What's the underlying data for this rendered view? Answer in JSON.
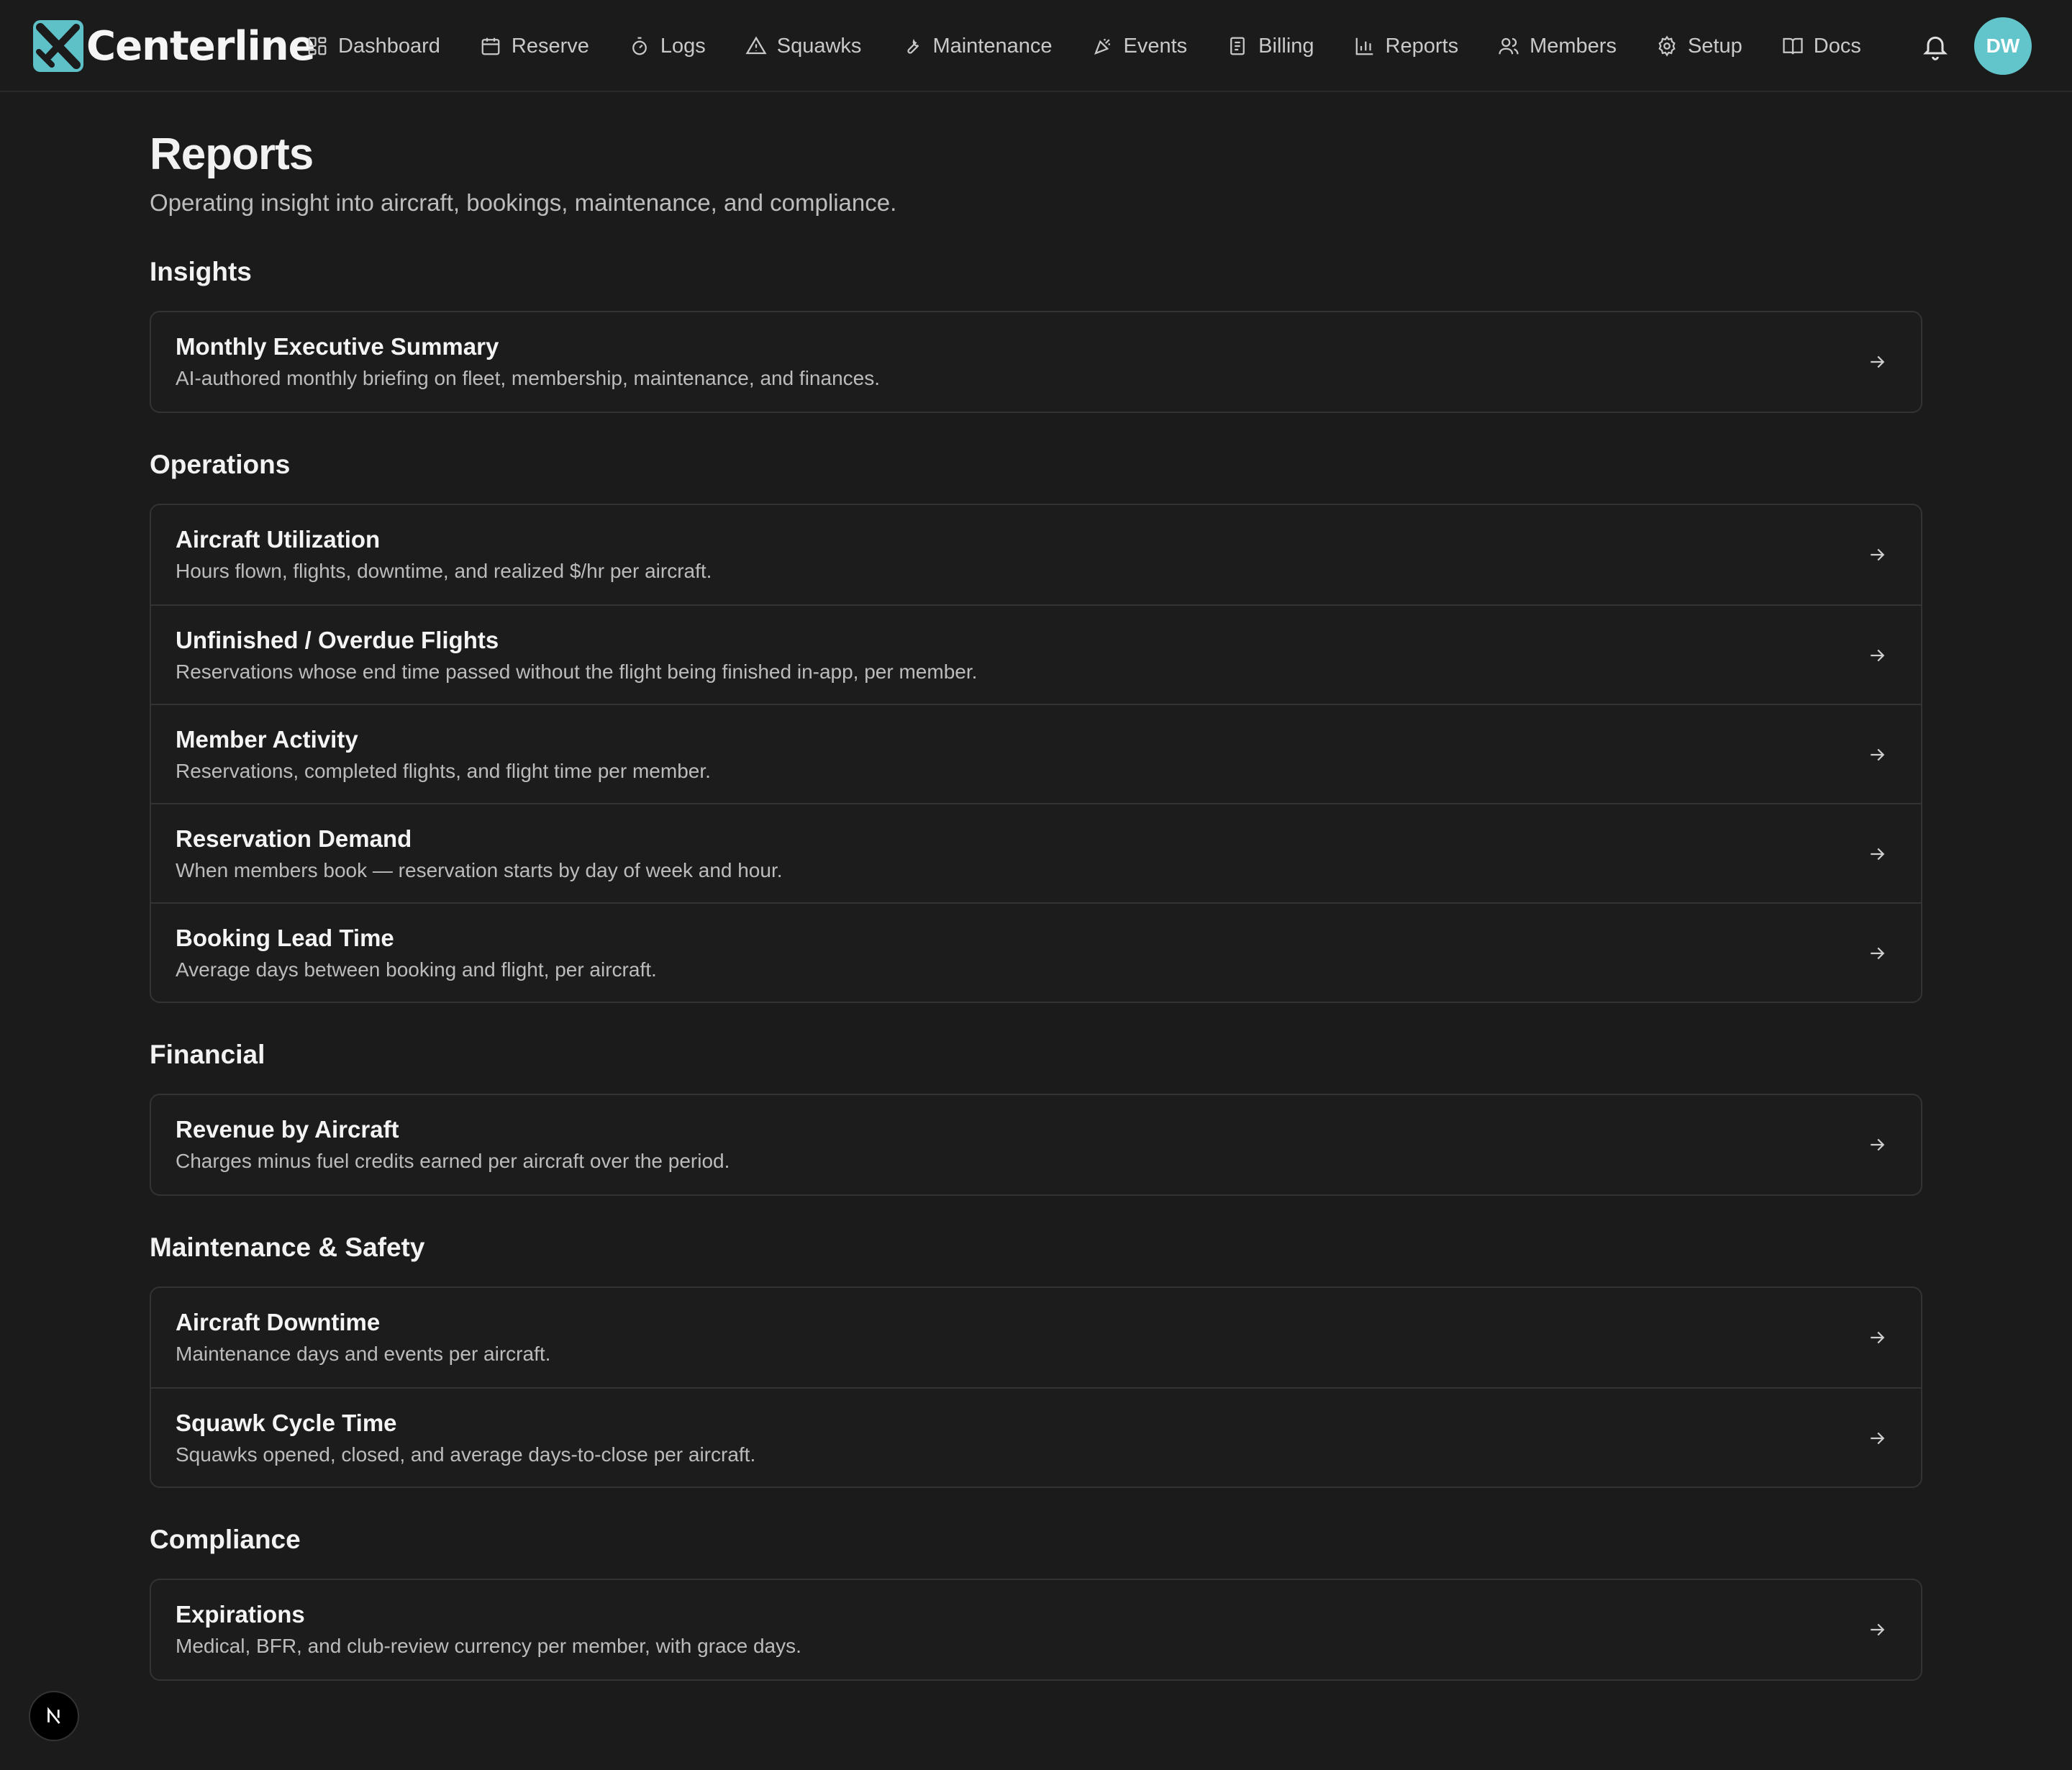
{
  "app": {
    "name": "Centerline",
    "brand_color": "#5ec1c8",
    "background": "#1b1b1b"
  },
  "nav": {
    "items": [
      {
        "label": "Dashboard",
        "icon": "dashboard-grid-icon"
      },
      {
        "label": "Reserve",
        "icon": "calendar-icon"
      },
      {
        "label": "Logs",
        "icon": "timer-icon"
      },
      {
        "label": "Squawks",
        "icon": "warning-triangle-icon"
      },
      {
        "label": "Maintenance",
        "icon": "wrench-icon"
      },
      {
        "label": "Events",
        "icon": "party-popper-icon"
      },
      {
        "label": "Billing",
        "icon": "receipt-icon"
      },
      {
        "label": "Reports",
        "icon": "bar-chart-icon"
      },
      {
        "label": "Members",
        "icon": "users-icon"
      },
      {
        "label": "Setup",
        "icon": "gear-icon"
      },
      {
        "label": "Docs",
        "icon": "book-icon"
      }
    ],
    "notifications_icon": "bell-icon",
    "avatar_initials": "DW",
    "avatar_color": "#62c5cc"
  },
  "page": {
    "title": "Reports",
    "subtitle": "Operating insight into aircraft, bookings, maintenance, and compliance."
  },
  "sections": [
    {
      "heading": "Insights",
      "reports": [
        {
          "title": "Monthly Executive Summary",
          "description": "AI-authored monthly briefing on fleet, membership, maintenance, and finances."
        }
      ]
    },
    {
      "heading": "Operations",
      "reports": [
        {
          "title": "Aircraft Utilization",
          "description": "Hours flown, flights, downtime, and realized $/hr per aircraft."
        },
        {
          "title": "Unfinished / Overdue Flights",
          "description": "Reservations whose end time passed without the flight being finished in-app, per member."
        },
        {
          "title": "Member Activity",
          "description": "Reservations, completed flights, and flight time per member."
        },
        {
          "title": "Reservation Demand",
          "description": "When members book — reservation starts by day of week and hour."
        },
        {
          "title": "Booking Lead Time",
          "description": "Average days between booking and flight, per aircraft."
        }
      ]
    },
    {
      "heading": "Financial",
      "reports": [
        {
          "title": "Revenue by Aircraft",
          "description": "Charges minus fuel credits earned per aircraft over the period."
        }
      ]
    },
    {
      "heading": "Maintenance & Safety",
      "reports": [
        {
          "title": "Aircraft Downtime",
          "description": "Maintenance days and events per aircraft."
        },
        {
          "title": "Squawk Cycle Time",
          "description": "Squawks opened, closed, and average days-to-close per aircraft."
        }
      ]
    },
    {
      "heading": "Compliance",
      "reports": [
        {
          "title": "Expirations",
          "description": "Medical, BFR, and club-review currency per member, with grace days."
        }
      ]
    }
  ],
  "row_arrow_icon": "arrow-right-icon",
  "dev_badge": {
    "label": "N",
    "icon": "nextjs-badge-icon"
  }
}
